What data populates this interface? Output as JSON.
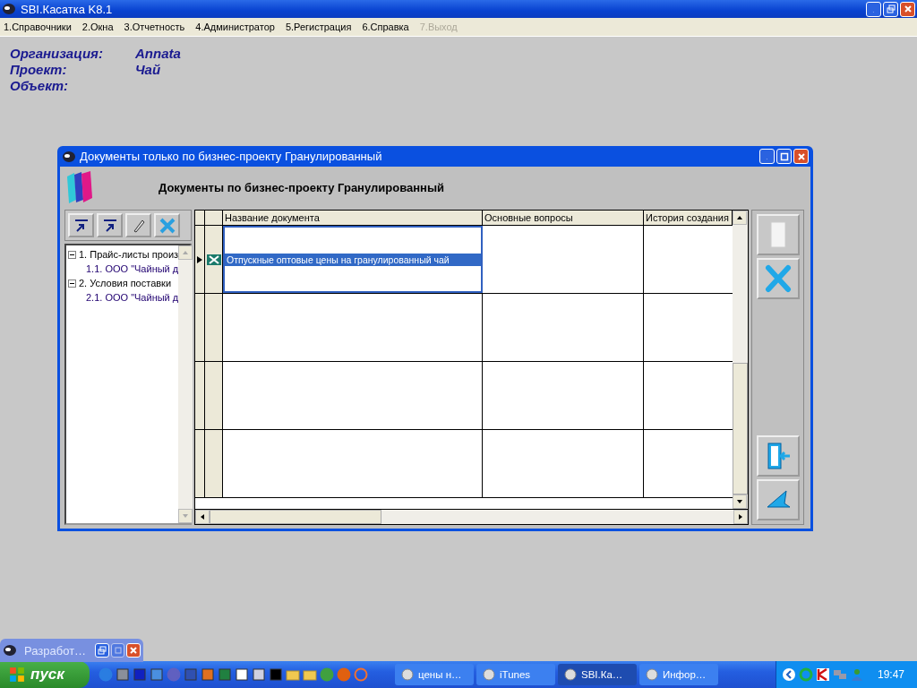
{
  "app": {
    "title": "SBI.Касатка K8.1"
  },
  "menu": [
    {
      "label": "1.Справочники",
      "disabled": false
    },
    {
      "label": "2.Окна",
      "disabled": false
    },
    {
      "label": "3.Отчетность",
      "disabled": false
    },
    {
      "label": "4.Администратор",
      "disabled": false
    },
    {
      "label": "5.Регистрация",
      "disabled": false
    },
    {
      "label": "6.Справка",
      "disabled": false
    },
    {
      "label": "7.Выход",
      "disabled": true
    }
  ],
  "info": [
    {
      "label": "Организация:",
      "value": "Annata"
    },
    {
      "label": "Проект:",
      "value": "Чай"
    },
    {
      "label": "Объект:"
    }
  ],
  "dialog": {
    "title": "Документы только по бизнес-проекту Гранулированный",
    "heading": "Документы по бизнес-проекту Гранулированный",
    "tree": [
      {
        "label": "1. Прайс-листы произ",
        "expanded": true,
        "children": [
          {
            "label": "1.1. ООО \"Чайный д"
          }
        ]
      },
      {
        "label": "2. Условия поставки",
        "expanded": true,
        "children": [
          {
            "label": "2.1. ООО \"Чайный д"
          }
        ]
      }
    ],
    "table": {
      "columns": [
        "Название документа",
        "Основные вопросы",
        "История создания"
      ],
      "rows": [
        {
          "cells": [
            "Отпускные оптовые цены на гранулированный чай"
          ],
          "selected": true
        }
      ]
    }
  },
  "minimized": {
    "title": "Разработ…"
  },
  "taskbar": {
    "start": "пуск",
    "tasks": [
      {
        "label": "цены н…",
        "selected": false
      },
      {
        "label": "iTunes",
        "selected": false
      },
      {
        "label": "SBI.Ка…",
        "selected": true
      },
      {
        "label": "Инфор…",
        "selected": false
      }
    ],
    "clock": "19:47"
  }
}
